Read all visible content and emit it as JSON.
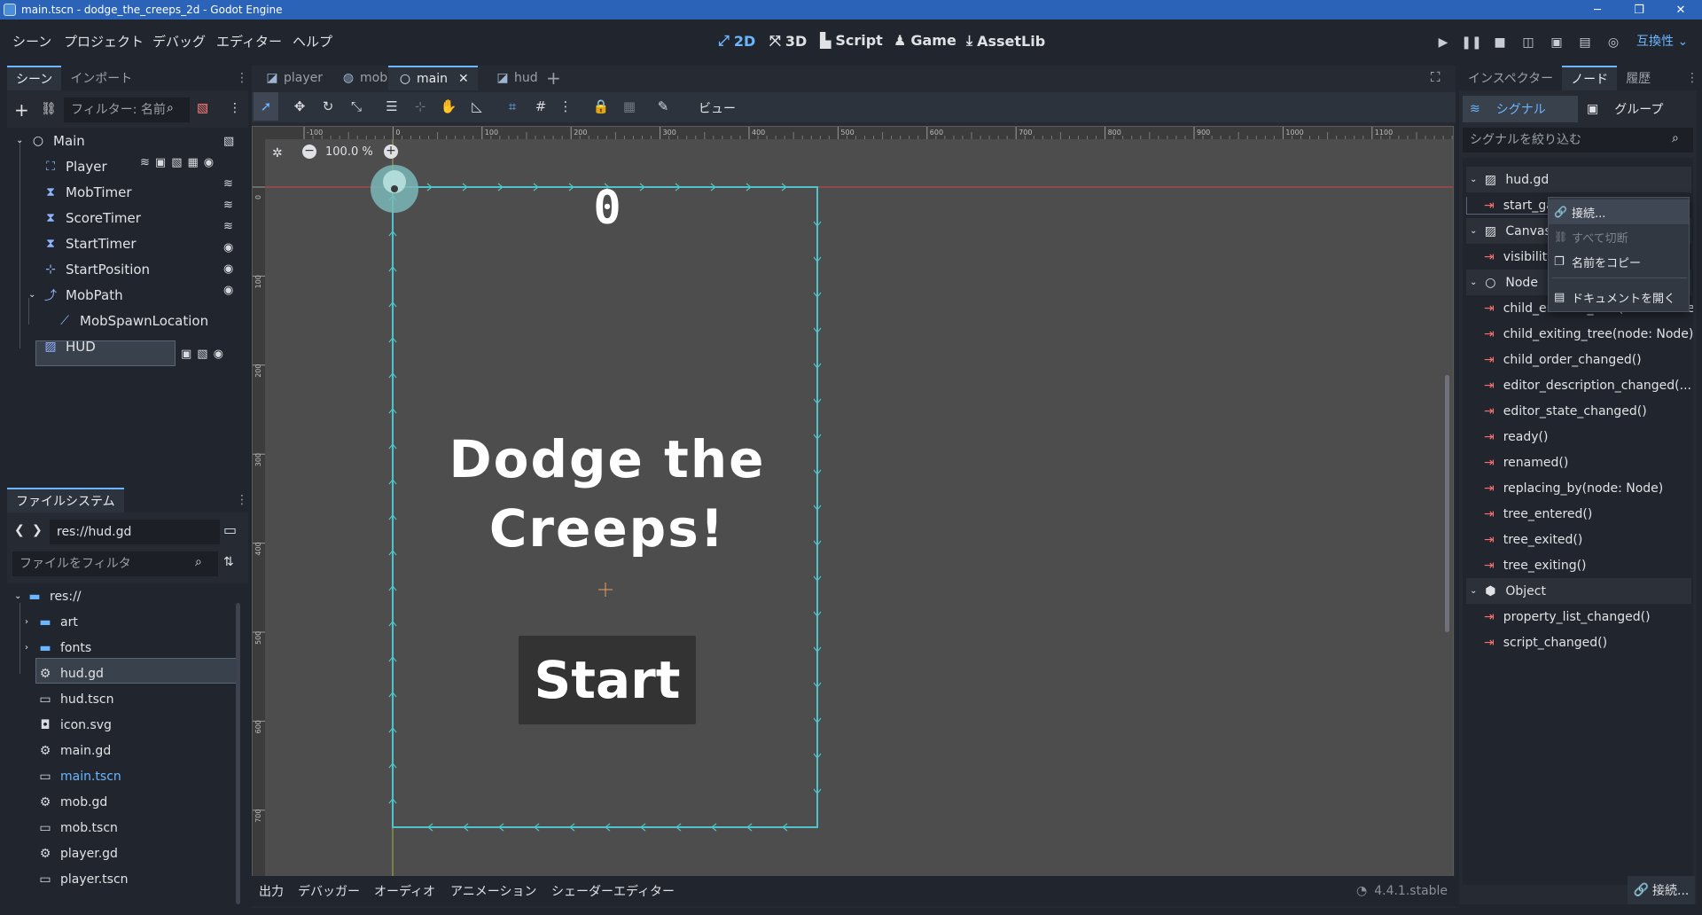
{
  "window": {
    "title": "main.tscn - dodge_the_creeps_2d - Godot Engine",
    "minimize": "─",
    "maximize": "❐",
    "close": "✕"
  },
  "menu": [
    "シーン",
    "プロジェクト",
    "デバッグ",
    "エディター",
    "ヘルプ"
  ],
  "workspaces": [
    {
      "label": "2D",
      "icon": "2d-icon",
      "glyph": "⤢",
      "active": true
    },
    {
      "label": "3D",
      "icon": "3d-icon",
      "glyph": "⤧",
      "active": false
    },
    {
      "label": "Script",
      "icon": "script-icon",
      "glyph": "▙",
      "active": false
    },
    {
      "label": "Game",
      "icon": "game-icon",
      "glyph": "♟",
      "active": false
    },
    {
      "label": "AssetLib",
      "icon": "assetlib-icon",
      "glyph": "⤓",
      "active": false
    }
  ],
  "renderer": "互換性",
  "scene_dock": {
    "tabs": [
      "シーン",
      "インポート"
    ],
    "filter_placeholder": "フィルター: 名前",
    "nodes": [
      {
        "name": "Main",
        "icon": "node2d-icon",
        "glyph": "○",
        "indent": 0
      },
      {
        "name": "Player",
        "icon": "area2d-icon",
        "glyph": "⛶",
        "indent": 1
      },
      {
        "name": "MobTimer",
        "icon": "timer-icon",
        "glyph": "⧗",
        "indent": 1
      },
      {
        "name": "ScoreTimer",
        "icon": "timer-icon",
        "glyph": "⧗",
        "indent": 1
      },
      {
        "name": "StartTimer",
        "icon": "timer-icon",
        "glyph": "⧗",
        "indent": 1
      },
      {
        "name": "StartPosition",
        "icon": "marker2d-icon",
        "glyph": "⊹",
        "indent": 1
      },
      {
        "name": "MobPath",
        "icon": "path2d-icon",
        "glyph": "⤴",
        "indent": 1
      },
      {
        "name": "MobSpawnLocation",
        "icon": "pathfollow-icon",
        "glyph": "⟋",
        "indent": 2
      },
      {
        "name": "HUD",
        "icon": "canvaslayer-icon",
        "glyph": "▨",
        "indent": 1
      }
    ]
  },
  "filesystem": {
    "tab": "ファイルシステム",
    "path": "res://hud.gd",
    "filter_placeholder": "ファイルをフィルタ",
    "items": [
      {
        "name": "res://",
        "icon": "folder-icon",
        "glyph": "▬",
        "indent": 0,
        "kind": "folder"
      },
      {
        "name": "art",
        "icon": "folder-icon",
        "glyph": "▬",
        "indent": 1,
        "kind": "folder"
      },
      {
        "name": "fonts",
        "icon": "folder-icon",
        "glyph": "▬",
        "indent": 1,
        "kind": "folder"
      },
      {
        "name": "hud.gd",
        "icon": "gear-icon",
        "glyph": "⚙",
        "indent": 1,
        "kind": "file"
      },
      {
        "name": "hud.tscn",
        "icon": "scene-icon",
        "glyph": "▭",
        "indent": 1,
        "kind": "file"
      },
      {
        "name": "icon.svg",
        "icon": "image-icon",
        "glyph": "◘",
        "indent": 1,
        "kind": "file"
      },
      {
        "name": "main.gd",
        "icon": "gear-icon",
        "glyph": "⚙",
        "indent": 1,
        "kind": "file"
      },
      {
        "name": "main.tscn",
        "icon": "scene-icon",
        "glyph": "▭",
        "indent": 1,
        "kind": "file"
      },
      {
        "name": "mob.gd",
        "icon": "gear-icon",
        "glyph": "⚙",
        "indent": 1,
        "kind": "file"
      },
      {
        "name": "mob.tscn",
        "icon": "scene-icon",
        "glyph": "▭",
        "indent": 1,
        "kind": "file"
      },
      {
        "name": "player.gd",
        "icon": "gear-icon",
        "glyph": "⚙",
        "indent": 1,
        "kind": "file"
      },
      {
        "name": "player.tscn",
        "icon": "scene-icon",
        "glyph": "▭",
        "indent": 1,
        "kind": "file"
      }
    ]
  },
  "editor_tabs": [
    {
      "label": "player",
      "icon": "canvas-icon",
      "glyph": "◪"
    },
    {
      "label": "mob",
      "icon": "globe-icon",
      "glyph": "◍"
    },
    {
      "label": "main",
      "icon": "node2d-icon",
      "glyph": "○",
      "close": "✕"
    },
    {
      "label": "hud",
      "icon": "canvas-icon",
      "glyph": "◪"
    }
  ],
  "toolbar": {
    "view_label": "ビュー",
    "zoom": "100.0 %"
  },
  "ruler_x": [
    "-100",
    "0",
    "100",
    "200",
    "300",
    "400",
    "500",
    "600",
    "700",
    "800",
    "900",
    "1000",
    "1100"
  ],
  "ruler_y": [
    "0",
    "100",
    "200",
    "300",
    "400",
    "500",
    "600",
    "700"
  ],
  "game": {
    "score": "0",
    "message_line1": "Dodge the",
    "message_line2": "Creeps!",
    "start": "Start"
  },
  "bottom_panel": {
    "tabs": [
      "出力",
      "デバッガー",
      "オーディオ",
      "アニメーション",
      "シェーダーエディター"
    ],
    "version": "4.4.1.stable"
  },
  "right_dock": {
    "tabs": [
      "インスペクター",
      "ノード",
      "履歴"
    ],
    "subtabs": [
      "シグナル",
      "グループ"
    ],
    "filter_placeholder": "シグナルを絞り込む",
    "sections": [
      {
        "type": "section",
        "label": "hud.gd",
        "icon": "script-icon",
        "glyph": "▨"
      },
      {
        "type": "signal",
        "label": "start_game()"
      },
      {
        "type": "section",
        "label": "CanvasLayer",
        "icon": "canvaslayer-icon",
        "glyph": "▨"
      },
      {
        "type": "signal",
        "label": "visibility_changed()"
      },
      {
        "type": "section",
        "label": "Node",
        "icon": "node-icon",
        "glyph": "○"
      },
      {
        "type": "signal",
        "label": "child_entered_tree(node: Node)"
      },
      {
        "type": "signal",
        "label": "child_exiting_tree(node: Node)"
      },
      {
        "type": "signal",
        "label": "child_order_changed()"
      },
      {
        "type": "signal",
        "label": "editor_description_changed(..."
      },
      {
        "type": "signal",
        "label": "editor_state_changed()"
      },
      {
        "type": "signal",
        "label": "ready()"
      },
      {
        "type": "signal",
        "label": "renamed()"
      },
      {
        "type": "signal",
        "label": "replacing_by(node: Node)"
      },
      {
        "type": "signal",
        "label": "tree_entered()"
      },
      {
        "type": "signal",
        "label": "tree_exited()"
      },
      {
        "type": "signal",
        "label": "tree_exiting()"
      },
      {
        "type": "section",
        "label": "Object",
        "icon": "object-icon",
        "glyph": "⬢"
      },
      {
        "type": "signal",
        "label": "property_list_changed()"
      },
      {
        "type": "signal",
        "label": "script_changed()"
      }
    ],
    "connect_button": "接続..."
  },
  "context_menu": [
    {
      "label": "接続...",
      "icon": "link-icon",
      "glyph": "🔗",
      "state": "hover"
    },
    {
      "label": "すべて切断",
      "icon": "unlink-icon",
      "glyph": "⛓",
      "state": "disabled"
    },
    {
      "label": "名前をコピー",
      "icon": "copy-icon",
      "glyph": "❐",
      "state": "normal"
    },
    {
      "label": "ドキュメントを開く",
      "icon": "doc-icon",
      "glyph": "▤",
      "state": "normal"
    }
  ],
  "colors": {
    "accent": "#6bb6ff",
    "titlebar": "#2a63b8",
    "signal": "#ff6e6e",
    "path": "#4fc3c9",
    "canvas": "#4d4d4d"
  }
}
